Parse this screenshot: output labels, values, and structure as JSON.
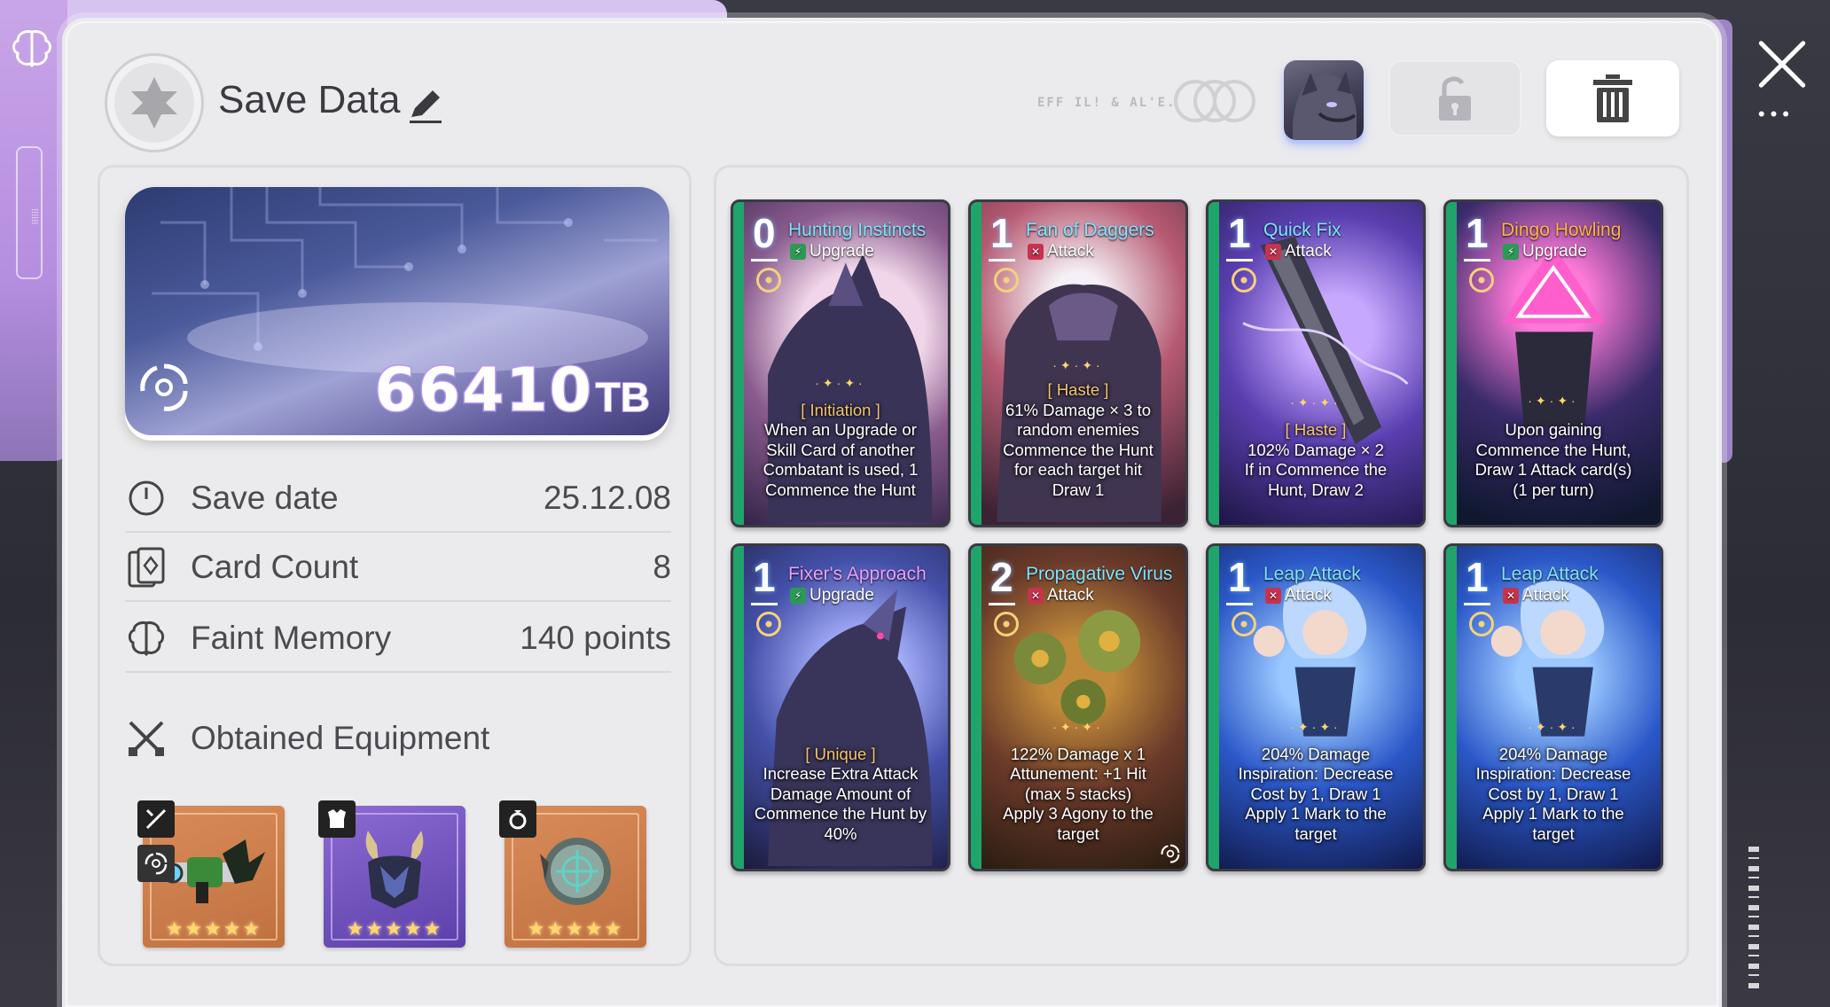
{
  "header": {
    "title": "Save Data",
    "faint_label": "EFF IL! & AL'E."
  },
  "info": {
    "tb_value": "66410",
    "tb_unit": "TB",
    "rows": [
      {
        "label": "Save date",
        "value": "25.12.08"
      },
      {
        "label": "Card Count",
        "value": "8"
      },
      {
        "label": "Faint Memory",
        "value": "140 points"
      }
    ],
    "equipment_title": "Obtained Equipment",
    "equipment": [
      {
        "slot": "weapon",
        "badge_icon": "sword-icon",
        "rarity": "orange",
        "stars": "★★★★★"
      },
      {
        "slot": "armor",
        "badge_icon": "armor-icon",
        "rarity": "purple",
        "stars": "★★★★★"
      },
      {
        "slot": "accessory",
        "badge_icon": "ring-icon",
        "rarity": "orange",
        "stars": "★★★★★"
      }
    ]
  },
  "cards": [
    {
      "cost": "0",
      "name": "Hunting Instincts",
      "type": "Upgrade",
      "keyword": "[ Initiation ]",
      "desc": [
        "When an Upgrade or",
        "Skill Card of another",
        "Combatant is used, 1",
        "Commence the Hunt"
      ]
    },
    {
      "cost": "1",
      "name": "Fan of Daggers",
      "type": "Attack",
      "keyword": "[ Haste ]",
      "desc": [
        "61% Damage × 3 to",
        "random enemies",
        "Commence the Hunt",
        "for each target hit",
        "Draw 1"
      ]
    },
    {
      "cost": "1",
      "name": "Quick Fix",
      "type": "Attack",
      "keyword": "[ Haste ]",
      "desc": [
        "102% Damage × 2",
        "If in Commence the",
        "Hunt, Draw 2"
      ]
    },
    {
      "cost": "1",
      "name": "Dingo Howling",
      "type": "Upgrade",
      "keyword": "",
      "desc": [
        "Upon gaining",
        "Commence the Hunt,",
        "Draw 1 Attack card(s)",
        "(1 per turn)"
      ]
    },
    {
      "cost": "1",
      "name": "Fixer's Approach",
      "type": "Upgrade",
      "keyword": "[ Unique ]",
      "desc": [
        "Increase Extra Attack",
        "Damage Amount of",
        "Commence the Hunt by",
        "40%"
      ]
    },
    {
      "cost": "2",
      "name": "Propagative Virus",
      "type": "Attack",
      "keyword": "",
      "desc": [
        "122% Damage x 1",
        "Attunement: +1 Hit",
        "(max 5 stacks)",
        "Apply 3 Agony to the",
        "target"
      ]
    },
    {
      "cost": "1",
      "name": "Leap Attack",
      "type": "Attack",
      "keyword": "",
      "desc": [
        "204% Damage",
        "Inspiration: Decrease",
        "Cost by 1, Draw 1",
        "Apply 1 Mark to the",
        "target"
      ]
    },
    {
      "cost": "1",
      "name": "Leap Attack",
      "type": "Attack",
      "keyword": "",
      "desc": [
        "204% Damage",
        "Inspiration: Decrease",
        "Cost by 1, Draw 1",
        "Apply 1 Mark to the",
        "target"
      ]
    }
  ],
  "colors": {
    "accent_purple": "#b796f0",
    "card_title_blue": "#7fe3ff",
    "card_title_orange": "#ffb34a",
    "keyword_gold": "#f3c46b",
    "upgrade_green": "#2a9a55",
    "attack_red": "#c8324c"
  }
}
